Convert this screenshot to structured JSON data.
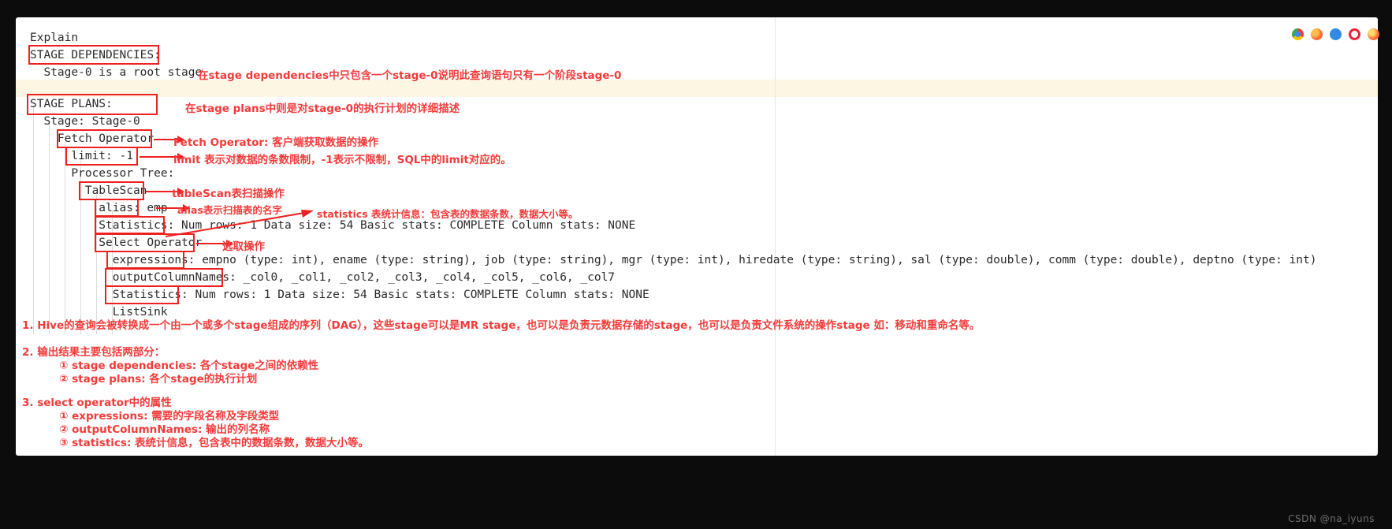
{
  "window": {
    "background": "#0c0c0c",
    "page_background": "#ffffff",
    "accent_red": "#ee2020",
    "annotation_red": "#f43a3a",
    "highlight_row_color": "#fdf6e3"
  },
  "icons": [
    {
      "name": "chrome-icon",
      "label": "Chrome"
    },
    {
      "name": "firefox-icon",
      "label": "Firefox"
    },
    {
      "name": "blue-dot-icon",
      "label": "Blue app"
    },
    {
      "name": "opera-icon",
      "label": "Opera"
    },
    {
      "name": "firefox-dev-icon",
      "label": "Firefox Developer"
    }
  ],
  "plan": {
    "lines": [
      {
        "id": "explain",
        "text": "Explain"
      },
      {
        "id": "stage-dependencies",
        "text": "STAGE DEPENDENCIES:"
      },
      {
        "id": "root-stage",
        "text": "  Stage-0 is a root stage"
      },
      {
        "id": "blank-1",
        "text": ""
      },
      {
        "id": "stage-plans",
        "text": "STAGE PLANS:"
      },
      {
        "id": "stage-0",
        "text": "  Stage: Stage-0"
      },
      {
        "id": "fetch-operator",
        "text": "    Fetch Operator"
      },
      {
        "id": "limit",
        "text": "      limit: -1"
      },
      {
        "id": "processor-tree",
        "text": "      Processor Tree:"
      },
      {
        "id": "tablescan",
        "text": "        TableScan"
      },
      {
        "id": "alias",
        "text": "          alias: emp"
      },
      {
        "id": "statistics-1",
        "text": "          Statistics: Num rows: 1 Data size: 54 Basic stats: COMPLETE Column stats: NONE"
      },
      {
        "id": "select-operator",
        "text": "          Select Operator"
      },
      {
        "id": "expressions",
        "text": "            expressions: empno (type: int), ename (type: string), job (type: string), mgr (type: int), hiredate (type: string), sal (type: double), comm (type: double), deptno (type: int)"
      },
      {
        "id": "output-column-names",
        "text": "            outputColumnNames: _col0, _col1, _col2, _col3, _col4, _col5, _col6, _col7"
      },
      {
        "id": "statistics-2",
        "text": "            Statistics: Num rows: 1 Data size: 54 Basic stats: COMPLETE Column stats: NONE"
      },
      {
        "id": "listsink",
        "text": "            ListSink"
      }
    ]
  },
  "annotations": [
    {
      "id": "a-stage-dependencies",
      "text": "在stage dependencies中只包含一个stage-0说明此查询语句只有一个阶段stage-0"
    },
    {
      "id": "a-stage-plans",
      "text": "在stage plans中则是对stage-0的执行计划的详细描述"
    },
    {
      "id": "a-fetch-operator",
      "text": "Fetch Operator: 客户端获取数据的操作"
    },
    {
      "id": "a-limit",
      "text": "limit 表示对数据的条数限制，-1表示不限制，SQL中的limit对应的。"
    },
    {
      "id": "a-tablescan",
      "text": "tableScan表扫描操作"
    },
    {
      "id": "a-alias",
      "text": "alias表示扫描表的名字"
    },
    {
      "id": "a-statistics",
      "text": "statistics 表统计信息：包含表的数据条数，数据大小等。"
    },
    {
      "id": "a-select-operator",
      "text": "选取操作"
    }
  ],
  "notes": [
    {
      "id": "note-1",
      "text": "1. Hive的查询会被转换成一个由一个或多个stage组成的序列（DAG），这些stage可以是MR stage，也可以是负责元数据存储的stage，也可以是负责文件系统的操作stage 如：移动和重命名等。"
    },
    {
      "id": "note-2",
      "text": "2. 输出结果主要包括两部分："
    },
    {
      "id": "note-2a",
      "text": "① stage dependencies:  各个stage之间的依赖性"
    },
    {
      "id": "note-2b",
      "text": "② stage plans:              各个stage的执行计划"
    },
    {
      "id": "note-3",
      "text": "3. select operator中的属性"
    },
    {
      "id": "note-3a",
      "text": "① expressions: 需要的字段名称及字段类型"
    },
    {
      "id": "note-3b",
      "text": "② outputColumnNames: 输出的列名称"
    },
    {
      "id": "note-3c",
      "text": "③ statistics: 表统计信息，包含表中的数据条数，数据大小等。"
    }
  ],
  "watermark": {
    "text": "CSDN @na_iyuns"
  }
}
